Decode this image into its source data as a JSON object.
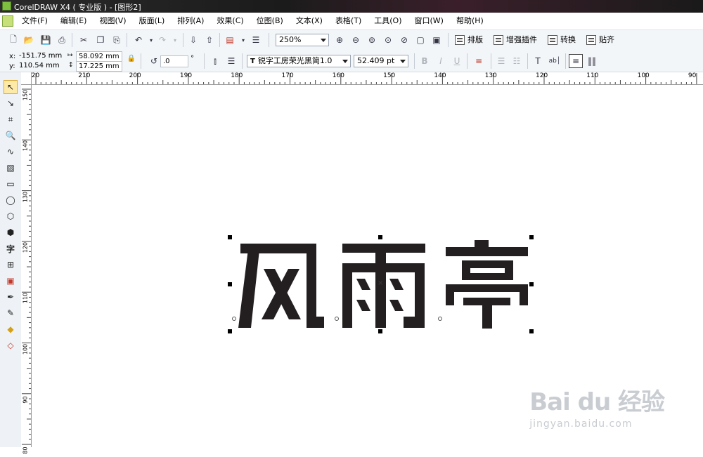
{
  "window": {
    "title": "CorelDRAW X4 ( 专业版 ) - [图形2]"
  },
  "menu": [
    "文件(F)",
    "编辑(E)",
    "视图(V)",
    "版面(L)",
    "排列(A)",
    "效果(C)",
    "位图(B)",
    "文本(X)",
    "表格(T)",
    "工具(O)",
    "窗口(W)",
    "帮助(H)"
  ],
  "standard_toolbar": {
    "zoom_value": "250%",
    "plugins": [
      {
        "label": "排版"
      },
      {
        "label": "增强插件"
      },
      {
        "label": "转换"
      },
      {
        "label": "贴齐"
      }
    ]
  },
  "property_bar": {
    "x_label": "x:",
    "x_value": "-151.75 mm",
    "y_label": "y:",
    "y_value": "110.54 mm",
    "width_value": "58.092 mm",
    "height_value": "17.225 mm",
    "rotation_value": ".0",
    "rotation_unit": "°",
    "font_name": "锐字工房荣光黑简1.0",
    "font_size": "52.409 pt",
    "align_buttons": [
      "B",
      "I",
      "U"
    ]
  },
  "rulers": {
    "horizontal_labels": [
      "220",
      "210",
      "200",
      "190",
      "180",
      "170",
      "160",
      "150",
      "140",
      "130",
      "120",
      "110",
      "100",
      "90"
    ],
    "vertical_labels": [
      "150",
      "140",
      "130",
      "120",
      "110",
      "100",
      "90",
      "80"
    ]
  },
  "canvas": {
    "text_object": "风雨亭"
  },
  "watermark": {
    "logo": "Bai du 经验",
    "url": "jingyan.baidu.com"
  }
}
